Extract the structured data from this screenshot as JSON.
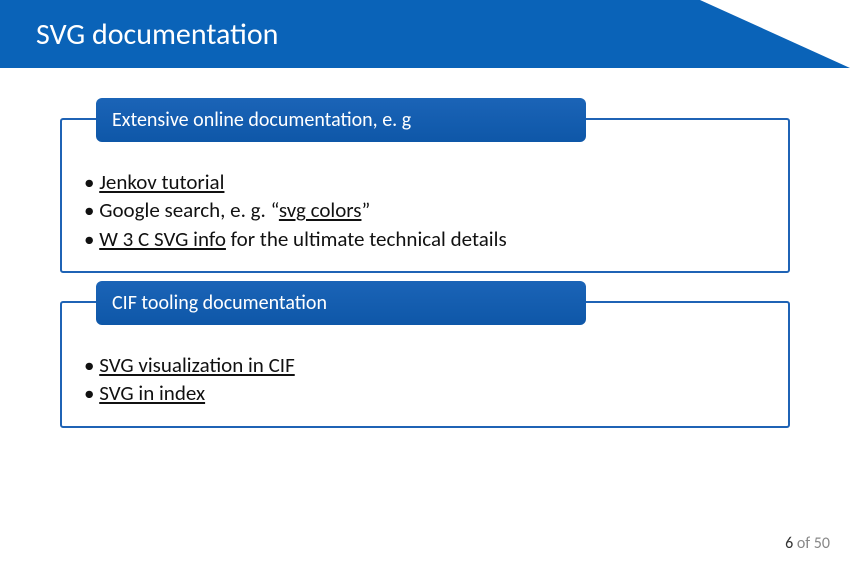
{
  "header": {
    "title": "SVG documentation"
  },
  "sections": [
    {
      "title": "Extensive online documentation, e. g",
      "items": [
        {
          "prefix": "",
          "link": "Jenkov tutorial",
          "suffix": ""
        },
        {
          "prefix": "Google search, e. g. “",
          "link": "svg colors",
          "suffix": "”"
        },
        {
          "prefix": "",
          "link": "W 3 C SVG info",
          "suffix": " for the ultimate technical details"
        }
      ]
    },
    {
      "title": "CIF tooling documentation",
      "items": [
        {
          "prefix": "",
          "link": "SVG visualization in CIF",
          "suffix": ""
        },
        {
          "prefix": "",
          "link": "SVG in index",
          "suffix": ""
        }
      ]
    }
  ],
  "footer": {
    "current": "6",
    "of": " of 50"
  }
}
